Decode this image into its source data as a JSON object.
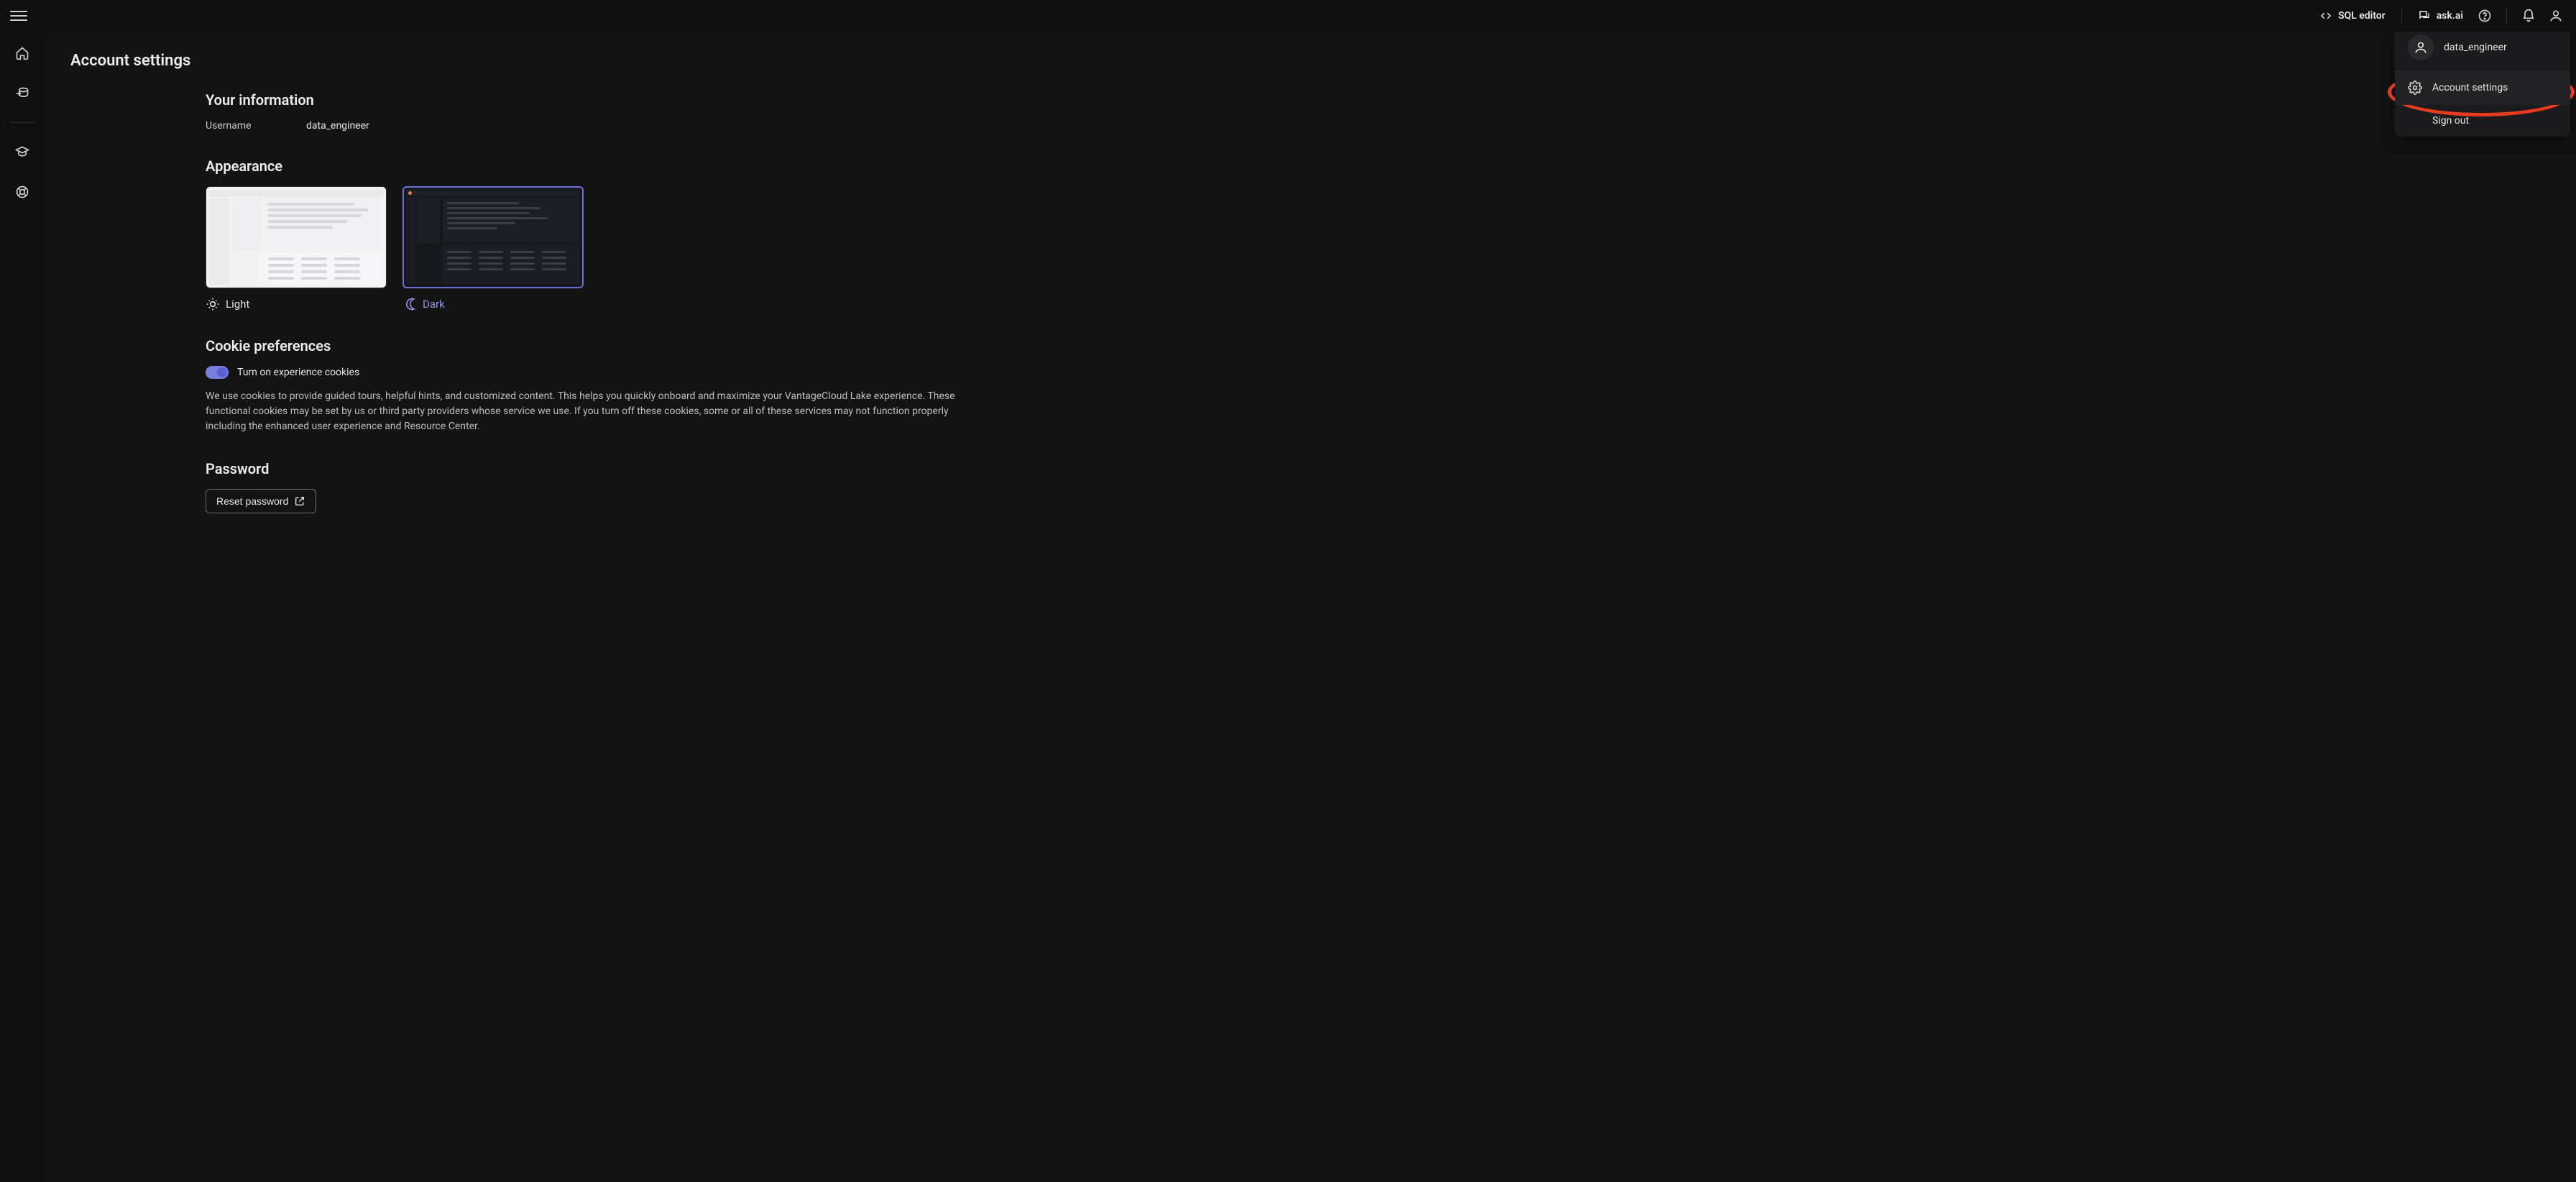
{
  "topbar": {
    "sql_editor_label": "SQL editor",
    "ask_ai_label": "ask.ai"
  },
  "sidebar": {
    "items": [
      {
        "name": "home"
      },
      {
        "name": "data"
      },
      {
        "name": "learn"
      },
      {
        "name": "help"
      }
    ]
  },
  "page": {
    "title": "Account settings"
  },
  "your_info": {
    "heading": "Your information",
    "username_label": "Username",
    "username_value": "data_engineer"
  },
  "appearance": {
    "heading": "Appearance",
    "light_label": "Light",
    "dark_label": "Dark",
    "selected": "dark"
  },
  "cookies": {
    "heading": "Cookie preferences",
    "toggle_label": "Turn on experience cookies",
    "toggle_on": true,
    "description": "We use cookies to provide guided tours, helpful hints, and customized content. This helps you quickly onboard and maximize your VantageCloud Lake experience. These functional cookies may be set by us or third party providers whose service we use. If you turn off these cookies, some or all of these services may not function properly including the enhanced user experience and Resource Center."
  },
  "password": {
    "heading": "Password",
    "reset_label": "Reset password"
  },
  "user_menu": {
    "username": "data_engineer",
    "account_settings_label": "Account settings",
    "sign_out_label": "Sign out"
  },
  "colors": {
    "accent": "#6b6fd8",
    "highlight_ring": "#e63b1f"
  }
}
